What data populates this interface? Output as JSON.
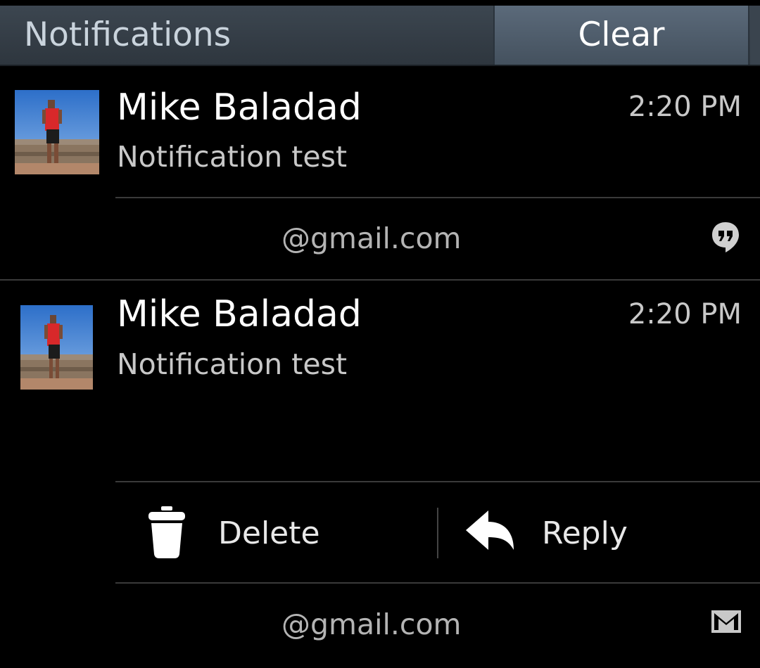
{
  "header": {
    "title": "Notifications",
    "clear_label": "Clear"
  },
  "notifications": [
    {
      "sender": "Mike Baladad",
      "message": "Notification test",
      "time": "2:20 PM",
      "account": "@gmail.com",
      "app_icon": "hangouts-icon"
    },
    {
      "sender": "Mike Baladad",
      "message": "Notification test",
      "time": "2:20 PM",
      "account": "@gmail.com",
      "app_icon": "gmail-icon",
      "actions": [
        {
          "label": "Delete",
          "icon": "trash-icon"
        },
        {
          "label": "Reply",
          "icon": "reply-icon"
        }
      ]
    }
  ],
  "colors": {
    "background": "#000000",
    "header": "#2e363e",
    "clear_button": "#4f5d6b",
    "divider": "#3a3a3a"
  }
}
